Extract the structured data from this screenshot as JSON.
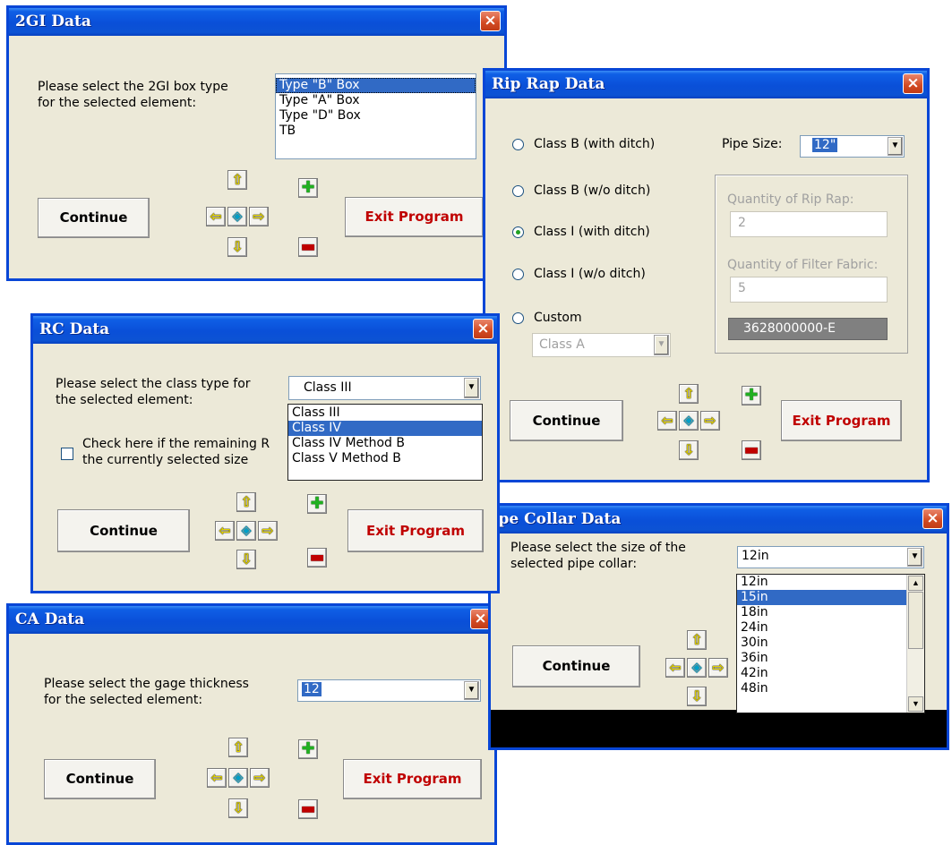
{
  "icons": {
    "close": "×",
    "up": "⇧",
    "down": "⇩",
    "left": "⇦",
    "right": "⇨",
    "center": "◈",
    "plus": "✚",
    "minus": "▬",
    "dropdown": "▼",
    "scroll_up": "▲"
  },
  "dlg_2gi": {
    "title": "2GI Data",
    "prompt_1": "Please select the 2GI box type",
    "prompt_2": "for the selected element:",
    "options": [
      "Type \"B\" Box",
      "Type \"A\" Box",
      "Type \"D\" Box",
      "TB"
    ],
    "continue": "Continue",
    "exit": "Exit Program"
  },
  "dlg_riprap": {
    "title": "Rip Rap Data",
    "radio_class_b_ditch": "Class B (with ditch)",
    "radio_class_b_noditch": "Class B (w/o ditch)",
    "radio_class_i_ditch": "Class I (with ditch)",
    "radio_class_i_noditch": "Class I (w/o ditch)",
    "radio_custom": "Custom",
    "custom_value": "Class A",
    "pipe_size_label": "Pipe Size:",
    "pipe_size_value": "12\"",
    "qty_riprap_label": "Quantity of Rip Rap:",
    "qty_riprap_value": "2",
    "qty_filter_label": "Quantity of Filter Fabric:",
    "qty_filter_value": "5",
    "code": "3628000000-E",
    "continue": "Continue",
    "exit": "Exit Program"
  },
  "dlg_rc": {
    "title": "RC Data",
    "prompt_1": "Please select the class type for",
    "prompt_2": "the selected element:",
    "combo_value": "Class III",
    "options": [
      "Class III",
      "Class IV",
      "Class IV Method B",
      "Class V Method B"
    ],
    "check_1": "Check here if the remaining R",
    "check_2": "the currently selected size",
    "continue": "Continue",
    "exit": "Exit Program"
  },
  "dlg_pipecollar": {
    "title": "ipe Collar Data",
    "prompt_1": "Please select the size of the",
    "prompt_2": "selected pipe collar:",
    "combo_value": "12in",
    "options": [
      "12in",
      "15in",
      "18in",
      "24in",
      "30in",
      "36in",
      "42in",
      "48in"
    ],
    "continue": "Continue"
  },
  "dlg_ca": {
    "title": "CA Data",
    "prompt_1": "Please select the gage thickness",
    "prompt_2": "for the selected element:",
    "combo_value": "12",
    "continue": "Continue",
    "exit": "Exit Program"
  }
}
